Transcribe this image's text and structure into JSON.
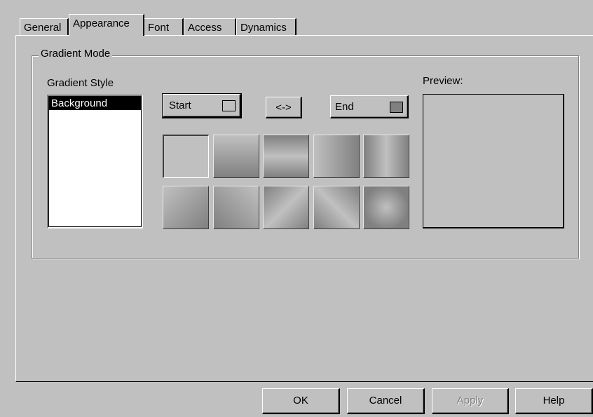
{
  "tabs": [
    {
      "label": "General"
    },
    {
      "label": "Appearance",
      "active": true
    },
    {
      "label": "Font"
    },
    {
      "label": "Access"
    },
    {
      "label": "Dynamics"
    }
  ],
  "group": {
    "title": "Gradient Mode"
  },
  "gradient_style": {
    "label": "Gradient Style",
    "items": [
      "Background"
    ],
    "selected": "Background"
  },
  "buttons": {
    "start_label": "Start",
    "swap_label": "<->",
    "end_label": "End"
  },
  "colors": {
    "start": "#c0c0c0",
    "end": "#808080",
    "dialog_face": "#c0c0c0"
  },
  "gradient_tiles": [
    "solid",
    "vertical-down",
    "vertical-mirror",
    "horizontal-right",
    "horizontal-mirror",
    "diagonal-down",
    "diagonal-up",
    "diagonal-mirror-down",
    "diagonal-mirror-up",
    "radial"
  ],
  "preview": {
    "label": "Preview:"
  },
  "footer": {
    "ok_label": "OK",
    "cancel_label": "Cancel",
    "apply_label": "Apply",
    "help_label": "Help",
    "apply_enabled": false
  }
}
